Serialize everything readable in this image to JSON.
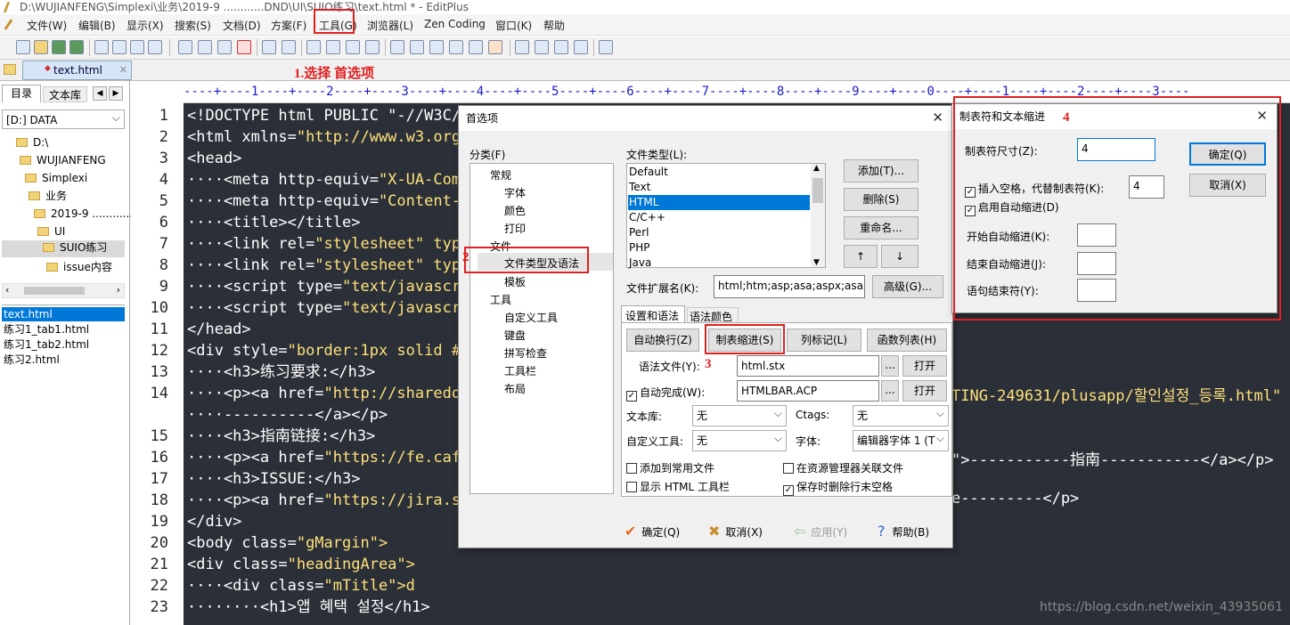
{
  "window": {
    "title": "D:\\WUJIANFENG\\Simplexi\\业务\\2019-9 ............DND\\UI\\SUIO练习\\text.html * - EditPlus"
  },
  "menu": [
    "文件(W)",
    "编辑(B)",
    "显示(X)",
    "搜索(S)",
    "文档(D)",
    "方案(F)",
    "工具(G)",
    "浏览器(L)",
    "Zen Coding",
    "窗口(K)",
    "帮助"
  ],
  "tab": {
    "label": "text.html"
  },
  "sidebar": {
    "tabs": [
      "目录",
      "文本库"
    ],
    "drive": "[D:] DATA",
    "tree": [
      "D:\\",
      "WUJIANFENG",
      "Simplexi",
      "业务",
      "2019-9 ............",
      "UI",
      "SUIO练习",
      "issue内容"
    ],
    "files": [
      "text.html",
      "练习1_tab1.html",
      "练习1_tab2.html",
      "练习2.html"
    ]
  },
  "ruler": {
    "text": "----+----1----+----2----+----3----+----4----+----5----+----6----+----7----+----8----+----9----+----0----+----1----+----2----+----3----"
  },
  "gutter": [
    "1",
    "2",
    "3",
    "4",
    "5",
    "6",
    "7",
    "8",
    "9",
    "10",
    "11",
    "12",
    "13",
    "14",
    "15",
    "16",
    "17",
    "18",
    "19",
    "20",
    "21",
    "22",
    "23"
  ],
  "code": [
    {
      "a": "<!DOCTYPE html PUBLIC \"-//W3C/",
      "b": ""
    },
    {
      "a": "<html xmlns=",
      "b": "\"http://www.w3.org"
    },
    {
      "a": "<head>",
      "b": ""
    },
    {
      "a": "····<meta http-equiv=",
      "b": "\"X-UA-Comp"
    },
    {
      "a": "····<meta http-equiv=",
      "b": "\"Content-Ty"
    },
    {
      "a": "····<title></title>",
      "b": ""
    },
    {
      "a": "····<link rel=",
      "b": "\"stylesheet\" type=\"te"
    },
    {
      "a": "····<link rel=",
      "b": "\"stylesheet\" type=\"te"
    },
    {
      "a": "····<script type=",
      "b": "\"text/javascript\" s"
    },
    {
      "a": "····<script type=",
      "b": "\"text/javascript\" s"
    },
    {
      "a": "</head>",
      "b": ""
    },
    {
      "a": "<div style=",
      "b": "\"border:1px solid #ff00"
    },
    {
      "a": "····<h3>练习要求:</h3>",
      "b": ""
    },
    {
      "a": "····<p><a href=",
      "b": "\"http://sharedocs."
    },
    {
      "a": "····----------</a></p>",
      "b": ""
    },
    {
      "a": "····<h3>指南链接:</h3>",
      "b": ""
    },
    {
      "a": "····<p><a href=",
      "b": "\"https://fe.cafe24"
    },
    {
      "a": "····<h3>ISSUE:</h3>",
      "b": ""
    },
    {
      "a": "····<p><a href=",
      "b": "\"https://jira.simpl"
    },
    {
      "a": "</div>",
      "b": ""
    },
    {
      "a": "<body class=",
      "b": "\"gMargin\">"
    },
    {
      "a": "<div class=",
      "b": "\"headingArea\">"
    },
    {
      "a": "····<div class=",
      "b": "\"mTitle\">d"
    },
    {
      "a": "········<h1>앱 혜택 설정</h1>",
      "b": ""
    }
  ],
  "code_right": {
    "line14": "TING-249631/plusapp/할인설정_등록.html\" ta",
    "line16": "\">-----------指南-----------</a></p>",
    "line18": "e---------</p>"
  },
  "prefs": {
    "title": "首选项",
    "category_label": "分类(F)",
    "categories": [
      "常规",
      "字体",
      "颜色",
      "打印",
      "文件",
      "文件类型及语法",
      "模板",
      "工具",
      "自定义工具",
      "键盘",
      "拼写检查",
      "工具栏",
      "布局"
    ],
    "filetype_label": "文件类型(L):",
    "filetypes": [
      "Default",
      "Text",
      "HTML",
      "C/C++",
      "Perl",
      "PHP",
      "Java"
    ],
    "buttons_right": [
      "添加(T)...",
      "删除(S)",
      "重命名..."
    ],
    "ext_label": "文件扩展名(K):",
    "ext_value": "html;htm;asp;asa;aspx;asax;s",
    "advanced": "高级(G)...",
    "subtabs": [
      "设置和语法",
      "语法颜色"
    ],
    "row_buttons": [
      "自动换行(Z)",
      "制表缩进(S)",
      "列标记(L)",
      "函数列表(H)"
    ],
    "syntax_file_label": "语法文件(Y):",
    "syntax_file": "html.stx",
    "autocomplete_label": "自动完成(W):",
    "autocomplete": "HTMLBAR.ACP",
    "open": "打开",
    "browse": "...",
    "library_label": "文本库:",
    "library": "无",
    "ctags_label": "Ctags:",
    "ctags": "无",
    "custom_tools_label": "自定义工具:",
    "custom_tools": "无",
    "font_label": "字体:",
    "font": "编辑器字体 1 (T",
    "checks": [
      "添加到常用文件",
      "在资源管理器关联文件",
      "显示 HTML 工具栏",
      "保存时删除行末空格"
    ],
    "ok": "确定(Q)",
    "cancel": "取消(X)",
    "apply": "应用(Y)",
    "help": "帮助(B)"
  },
  "tabdlg": {
    "title": "制表符和文本缩进",
    "tab_size_label": "制表符尺寸(Z):",
    "tab_size": "4",
    "insert_spaces_label": "插入空格，代替制表符(K):",
    "indent": "4",
    "auto_indent_label": "启用自动缩进(D)",
    "start_label": "开始自动缩进(K):",
    "end_label": "结束自动缩进(J):",
    "stmt_label": "语句结束符(Y):",
    "ok": "确定(Q)",
    "cancel": "取消(X)"
  },
  "annotations": {
    "step1": "1.选择 首选项",
    "step2": "2",
    "step3": "3",
    "step4": "4"
  },
  "watermark": "https://blog.csdn.net/weixin_43935061",
  "colors": {
    "editor_bg": "#2b3038",
    "attr_name": "#f07a94",
    "attr_value": "#ffe07a",
    "annotation": "#e02020",
    "selection": "#0078d7"
  }
}
